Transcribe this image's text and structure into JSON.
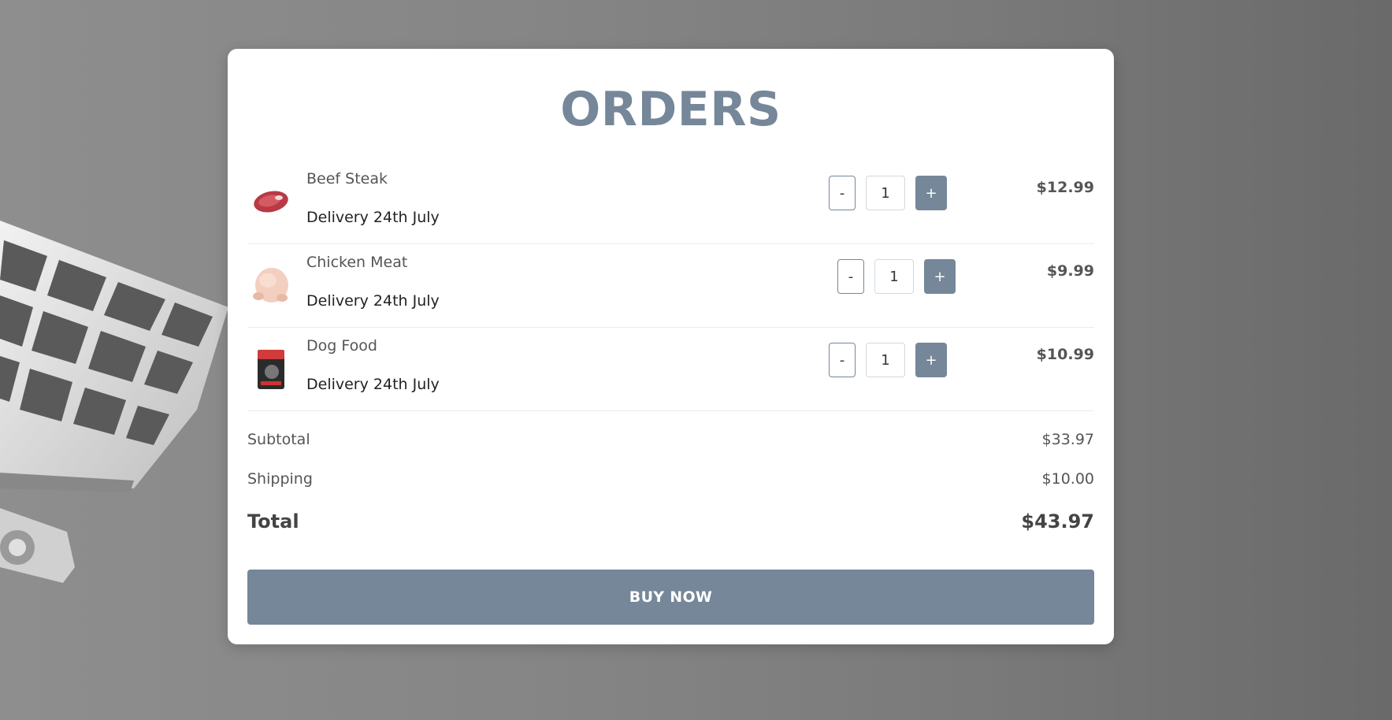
{
  "page": {
    "title": "ORDERS"
  },
  "orders": [
    {
      "name": "Beef Steak",
      "delivery": "Delivery 24th July",
      "quantity": "1",
      "price": "$12.99",
      "image": "beef-steak-image"
    },
    {
      "name": "Chicken Meat",
      "delivery": "Delivery 24th July",
      "quantity": "1",
      "price": "$9.99",
      "image": "chicken-meat-image"
    },
    {
      "name": "Dog Food",
      "delivery": "Delivery 24th July",
      "quantity": "1",
      "price": "$10.99",
      "image": "dog-food-image"
    }
  ],
  "controls": {
    "minus": "-",
    "plus": "+"
  },
  "summary": {
    "subtotal_label": "Subtotal",
    "subtotal": "$33.97",
    "shipping_label": "Shipping",
    "shipping": "$10.00",
    "total_label": "Total",
    "total": "$43.97"
  },
  "buy_label": "BUY NOW",
  "colors": {
    "accent": "#758799",
    "card": "#ffffff"
  }
}
